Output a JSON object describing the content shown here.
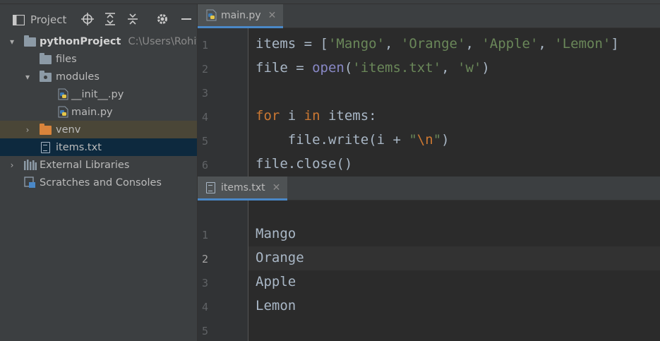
{
  "project": {
    "title": "Project",
    "tree": [
      {
        "label": "pythonProject",
        "path": "C:\\Users\\Rohit\\Py"
      },
      {
        "label": "files"
      },
      {
        "label": "modules"
      },
      {
        "label": "__init__.py"
      },
      {
        "label": "main.py"
      },
      {
        "label": "venv"
      },
      {
        "label": "items.txt"
      },
      {
        "label": "External Libraries"
      },
      {
        "label": "Scratches and Consoles"
      }
    ]
  },
  "editor_main": {
    "tab_label": "main.py",
    "line_numbers": [
      "1",
      "2",
      "3",
      "4",
      "5",
      "6"
    ]
  },
  "editor_items": {
    "tab_label": "items.txt",
    "line_numbers": [
      "1",
      "2",
      "3",
      "4",
      "5"
    ],
    "lines": [
      "Mango",
      "Orange",
      "Apple",
      "Lemon",
      ""
    ]
  },
  "colors": {
    "background": "#2b2b2b",
    "panel": "#3c3f41",
    "selection": "#0d293e",
    "keyword": "#cc7832",
    "string": "#6a8759",
    "builtin": "#8888c6",
    "text": "#a9b7c6"
  }
}
